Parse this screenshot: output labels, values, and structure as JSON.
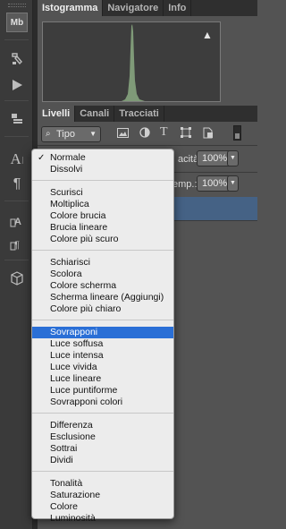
{
  "tools": [
    "mb-icon",
    "history-brush-icon",
    "play-icon",
    "layer-comps-icon",
    "character-icon",
    "paragraph-icon",
    "character-styles-icon",
    "paragraph-styles-icon",
    "3d-icon"
  ],
  "tools_text": {
    "mb": "Mb",
    "char": "A",
    "para": "¶"
  },
  "top_panel": {
    "tabs": [
      "Istogramma",
      "Navigatore",
      "Info"
    ],
    "warning": "▲"
  },
  "layers_panel": {
    "tabs": [
      "Livelli",
      "Canali",
      "Tracciati"
    ],
    "filter_kind": "Tipo",
    "opacity_label": "acità:",
    "opacity_value": "100%",
    "fill_label": "emp.:",
    "fill_value": "100%"
  },
  "blend_menu": {
    "groups": [
      [
        "Normale",
        "Dissolvi"
      ],
      [
        "Scurisci",
        "Moltiplica",
        "Colore brucia",
        "Brucia lineare",
        "Colore più scuro"
      ],
      [
        "Schiarisci",
        "Scolora",
        "Colore scherma",
        "Scherma lineare (Aggiungi)",
        "Colore più chiaro"
      ],
      [
        "Sovrapponi",
        "Luce soffusa",
        "Luce intensa",
        "Luce vivida",
        "Luce lineare",
        "Luce puntiforme",
        "Sovrapponi colori"
      ],
      [
        "Differenza",
        "Esclusione",
        "Sottrai",
        "Dividi"
      ],
      [
        "Tonalità",
        "Saturazione",
        "Colore",
        "Luminosità"
      ]
    ],
    "checked": "Normale",
    "highlighted": "Sovrapponi",
    "checkmark": "✓"
  },
  "colors": {
    "highlight": "#2a6fd6",
    "histogram": "#7f9a78",
    "panel": "#535353"
  }
}
